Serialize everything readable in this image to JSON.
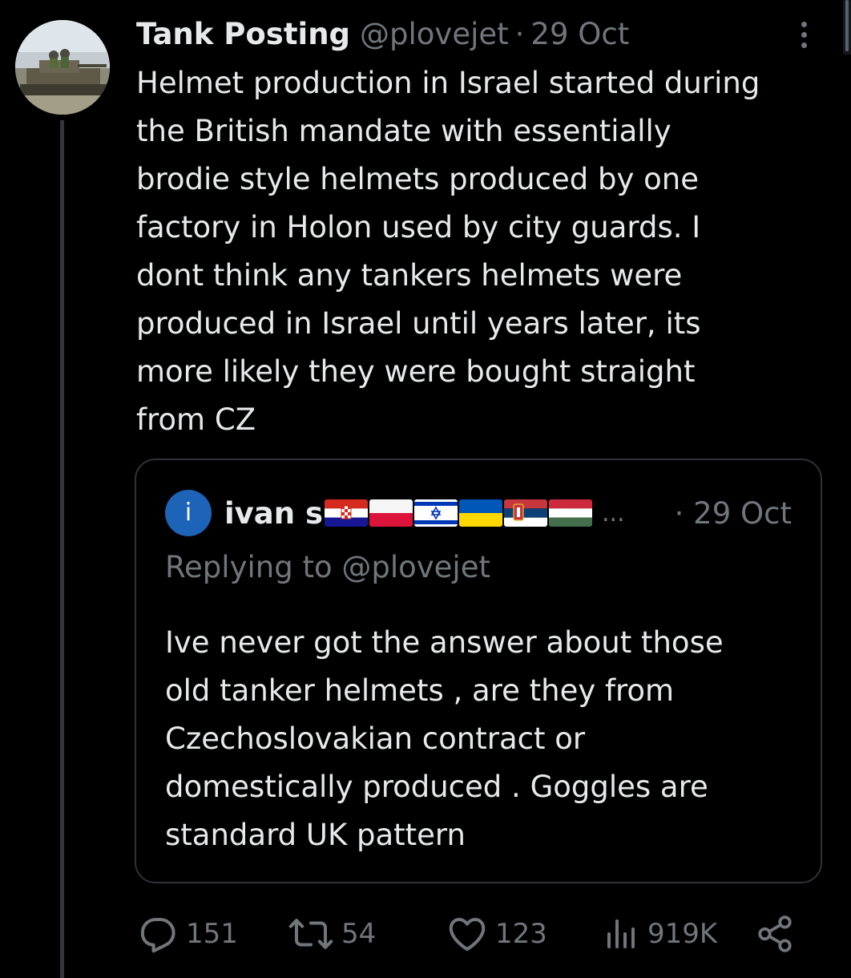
{
  "tweet": {
    "display_name": "Tank Posting",
    "handle": "@plovejet",
    "separator": "·",
    "date": "29 Oct",
    "text": "Helmet production in Israel started during\nthe British mandate with essentially\nbrodie style helmets produced by one\nfactory in Holon used by city guards. I\ndont think any tankers helmets were\nproduced in Israel until years later, its\nmore likely they were bought straight\nfrom CZ"
  },
  "quote": {
    "avatar_letter": "i",
    "display_name": "ivan s",
    "flags": [
      "croatia-flag",
      "poland-flag",
      "israel-flag",
      "ukraine-flag",
      "serbia-flag",
      "hungary-flag"
    ],
    "ellipsis": "...",
    "date": "· 29 Oct",
    "replying_to": "Replying to @plovejet",
    "text": "Ive never got the answer about those\nold tanker helmets , are they from\nCzechoslovakian contract or\ndomestically produced . Goggles are\nstandard UK pattern"
  },
  "actions": {
    "replies": "151",
    "reposts": "54",
    "likes": "123",
    "views": "919K"
  },
  "colors": {
    "background": "#000000",
    "text_primary": "#e7e9ea",
    "text_secondary": "#71767b",
    "border": "#2f3336",
    "quote_avatar": "#1d64b8"
  },
  "icons": [
    "reply-icon",
    "repost-icon",
    "like-icon",
    "views-icon",
    "share-icon",
    "more-icon"
  ]
}
